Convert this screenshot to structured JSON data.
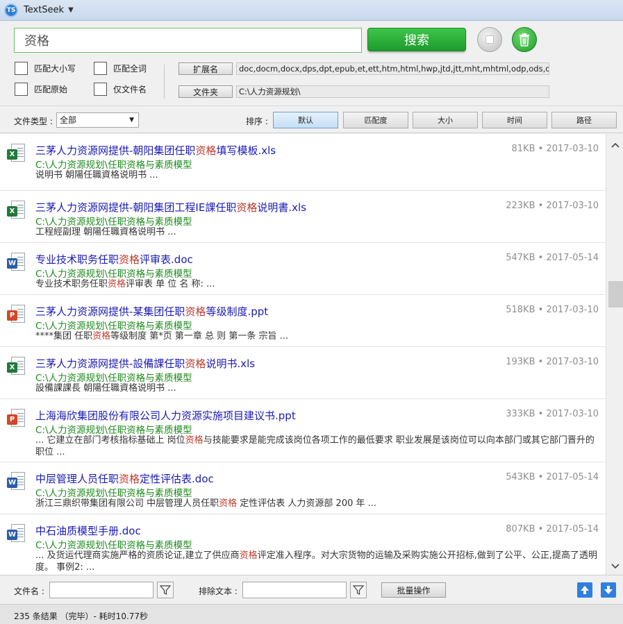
{
  "app": {
    "logo_text": "TS",
    "title": "TextSeek"
  },
  "search": {
    "query": "资格",
    "search_label": "搜索",
    "options": [
      {
        "label": "匹配大小写"
      },
      {
        "label": "匹配全词"
      },
      {
        "label": "匹配原始"
      },
      {
        "label": "仅文件名"
      }
    ],
    "ext_label": "扩展名",
    "ext_value": "doc,docm,docx,dps,dpt,epub,et,ett,htm,html,hwp,jtd,jtt,mht,mhtml,odp,ods,odt,ofd,p",
    "folder_label": "文件夹",
    "folder_value": "C:\\人力资源规划\\"
  },
  "filter": {
    "type_label": "文件类型 :",
    "type_value": "全部",
    "sort_label": "排序 :",
    "sort_options": [
      "默认",
      "匹配度",
      "大小",
      "时间",
      "路径"
    ],
    "active_sort": "默认"
  },
  "results": [
    {
      "type": "xls",
      "title_pre": "三茅人力资源网提供-朝阳集团任职",
      "title_hl": "资格",
      "title_post": "填写模板.xls",
      "path": "C:\\人力资源规划\\任职资格与素质模型",
      "snippet_pre": "说明书 朝陽任職資格说明书 ...",
      "snippet_hl": "",
      "snippet_post": "",
      "size": "81KB",
      "date": "2017-03-10"
    },
    {
      "type": "xls",
      "title_pre": "三茅人力资源网提供-朝阳集团工程IE課任职",
      "title_hl": "资格",
      "title_post": "说明書.xls",
      "path": "C:\\人力资源规划\\任职资格与素质模型",
      "snippet_pre": "工程經副理 朝陽任職資格说明书 ...",
      "snippet_hl": "",
      "snippet_post": "",
      "size": "223KB",
      "date": "2017-03-10"
    },
    {
      "type": "doc",
      "title_pre": "专业技术职务任职",
      "title_hl": "资格",
      "title_post": "评审表.doc",
      "path": "C:\\人力资源规划\\任职资格与素质模型",
      "snippet_pre": "专业技术职务任职",
      "snippet_hl": "资格",
      "snippet_post": "评审表 单 位 名 称: ...",
      "size": "547KB",
      "date": "2017-05-14"
    },
    {
      "type": "ppt",
      "title_pre": "三茅人力资源网提供-某集团任职",
      "title_hl": "资格",
      "title_post": "等级制度.ppt",
      "path": "C:\\人力资源规划\\任职资格与素质模型",
      "snippet_pre": "****集团 任职",
      "snippet_hl": "资格",
      "snippet_post": "等级制度 第*页 第一章 总 则 第一条 宗旨 ...",
      "size": "518KB",
      "date": "2017-03-10"
    },
    {
      "type": "xls",
      "title_pre": "三茅人力资源网提供-設備課任职",
      "title_hl": "资格",
      "title_post": "说明书.xls",
      "path": "C:\\人力资源规划\\任职资格与素质模型",
      "snippet_pre": "設備課課長 朝陽任職資格说明书 ...",
      "snippet_hl": "",
      "snippet_post": "",
      "size": "193KB",
      "date": "2017-03-10"
    },
    {
      "type": "ppt",
      "title_pre": "上海海欣集团股份有限公司人力资源实施项目建议书.ppt",
      "title_hl": "",
      "title_post": "",
      "path": "C:\\人力资源规划\\任职资格与素质模型",
      "snippet_pre": "... 它建立在部门考核指标基础上 岗位",
      "snippet_hl": "资格",
      "snippet_post": "与技能要求是能完成该岗位各项工作的最低要求 职业发展是该岗位可以向本部门或其它部门晋升的职位 ...",
      "size": "333KB",
      "date": "2017-03-10"
    },
    {
      "type": "doc",
      "title_pre": "中层管理人员任职",
      "title_hl": "资格",
      "title_post": "定性评估表.doc",
      "path": "C:\\人力资源规划\\任职资格与素质模型",
      "snippet_pre": "浙江三鼎织带集团有限公司 中层管理人员任职",
      "snippet_hl": "资格",
      "snippet_post": " 定性评估表 人力资源部 200 年 ...",
      "size": "543KB",
      "date": "2017-05-14"
    },
    {
      "type": "doc",
      "title_pre": "中石油质模型手册.doc",
      "title_hl": "",
      "title_post": "",
      "path": "C:\\人力资源规划\\任职资格与素质模型",
      "snippet_pre": "... 及货运代理商实施严格的资质论证,建立了供应商",
      "snippet_hl": "资格",
      "snippet_post": "评定准入程序。对大宗货物的运输及采购实施公开招标,做到了公平、公正,提高了透明度。 事例2: ...",
      "size": "807KB",
      "date": "2017-05-14"
    }
  ],
  "bottom": {
    "filename_label": "文件名 :",
    "exclude_label": "排除文本 :",
    "batch_label": "批量操作"
  },
  "status": {
    "text": "235 条结果  （完毕）- 耗时10.77秒"
  },
  "colors": {
    "accent_green": "#1e9a2c",
    "title_blue": "#1a1ab5",
    "path_green": "#1d8b1d",
    "highlight_red": "#c0392b",
    "arrow_blue": "#2f7fe0"
  }
}
